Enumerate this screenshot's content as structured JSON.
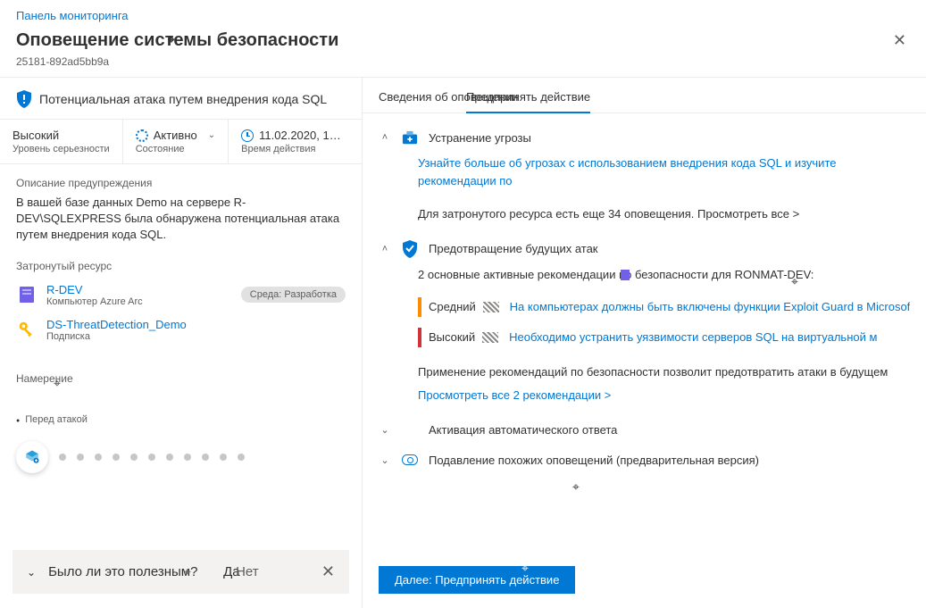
{
  "breadcrumb": "Панель мониторинга",
  "page_title": "Оповещение системы безопасности",
  "sub_id": "25181-892ad5bb9a",
  "alert_title": "Потенциальная атака путем внедрения кода SQL",
  "metrics": {
    "severity": {
      "value": "Высокий",
      "label": "Уровень серьезности"
    },
    "status": {
      "value": "Активно",
      "label": "Состояние"
    },
    "time": {
      "value": "11.02.2020, 1…",
      "label": "Время действия"
    }
  },
  "description": {
    "title": "Описание предупреждения",
    "text": "В вашей базе данных Demo на сервере R-DEV\\SQLEXPRESS была обнаружена потенциальная атака путем внедрения кода SQL."
  },
  "affected": {
    "title": "Затронутый ресурс",
    "items": [
      {
        "name": "R-DEV",
        "sub": "Компьютер Azure Arc",
        "badge": "Среда: Разработка",
        "icon": "server"
      },
      {
        "name": "DS-ThreatDetection_Demo",
        "sub": "Подписка",
        "badge": "",
        "icon": "key"
      }
    ]
  },
  "intent": {
    "title": "Намерение",
    "stage": "Перед атакой"
  },
  "helpful": {
    "question": "Было ли это полезным?",
    "yes": "Да",
    "no": "Нет"
  },
  "tabs": {
    "details": "Сведения об оповещении",
    "action": "Предпринять действие"
  },
  "accordion": {
    "threat": {
      "title": "Устранение угрозы",
      "learn_more": "Узнайте больше об угрозах с использованием внедрения кода SQL и изучите рекомендации по",
      "more_alerts": "Для затронутого ресурса есть еще 34 оповещения. Просмотреть все >"
    },
    "prevent": {
      "title": "Предотвращение будущих атак",
      "summary": "2 основные активные рекомендации по безопасности для RONMAT-DEV:",
      "recs": [
        {
          "sev": "Средний",
          "sev_class": "sev-orange",
          "text": "На компьютерах должны быть включены функции Exploit Guard в Microsoft"
        },
        {
          "sev": "Высокий",
          "sev_class": "sev-red",
          "text": "Необходимо устранить уязвимости серверов SQL на виртуальной м"
        }
      ],
      "footer": "Применение рекомендаций по безопасности позволит предотвратить атаки в будущем",
      "view_all": "Просмотреть все 2 рекомендации >"
    },
    "auto": {
      "title": "Активация автоматического ответа"
    },
    "suppress": {
      "title": "Подавление похожих оповещений (предварительная версия)"
    }
  },
  "footer_button": "Далее: Предпринять действие"
}
